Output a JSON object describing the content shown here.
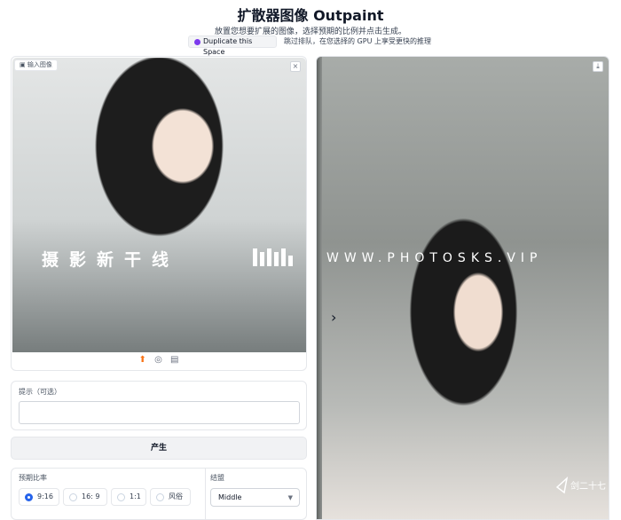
{
  "header": {
    "title": "扩散器图像 Outpaint",
    "subtitle": "放置您想要扩展的图像，选择预期的比例并点击生成。",
    "duplicate_button": "Duplicate this Space",
    "duplicate_text": "跳过排队，在您选择的 GPU 上享受更快的推理"
  },
  "input_image": {
    "badge": "输入图像",
    "close_icon": "×",
    "tools": [
      "upload-icon",
      "webcam-icon",
      "clipboard-icon"
    ]
  },
  "prompt": {
    "label": "提示（可选）",
    "value": "",
    "placeholder": ""
  },
  "generate_button": "产生",
  "ratio": {
    "label": "预期比率",
    "options": [
      "9:16",
      "16: 9",
      "1:1",
      "风俗"
    ],
    "selected": "9:16"
  },
  "alignment": {
    "label": "结盟",
    "value": "Middle"
  },
  "output": {
    "download_icon": "⤓",
    "arrow": "›"
  },
  "watermark": {
    "left": "摄影新干线",
    "right": "WWW.PHOTOSKS.VIP",
    "corner": "剑二十七"
  },
  "colors": {
    "accent": "#2563eb",
    "duplicate_dot": "#7c3aed"
  }
}
